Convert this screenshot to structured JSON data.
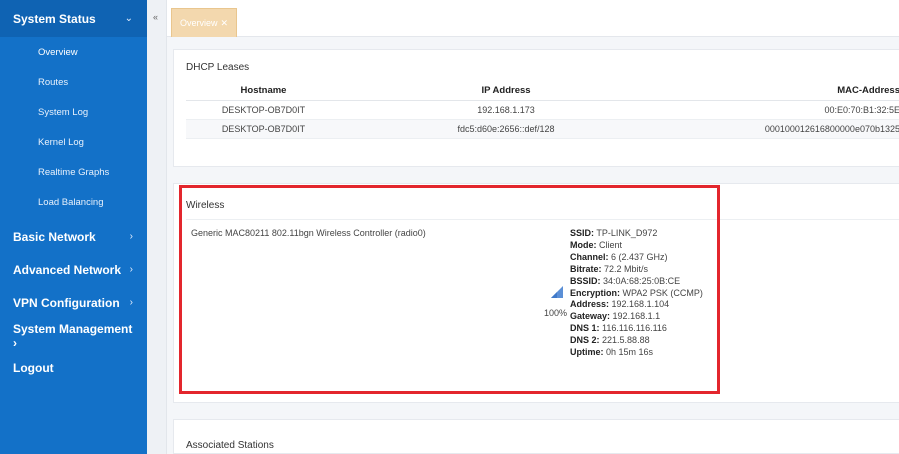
{
  "sidebar": {
    "system_status": {
      "label": "System Status",
      "caret": "⌄"
    },
    "sub_items": [
      {
        "label": "Overview"
      },
      {
        "label": "Routes"
      },
      {
        "label": "System Log"
      },
      {
        "label": "Kernel Log"
      },
      {
        "label": "Realtime Graphs"
      },
      {
        "label": "Load Balancing"
      }
    ],
    "sections": [
      {
        "label": "Basic Network",
        "caret": "›"
      },
      {
        "label": "Advanced Network",
        "caret": "›"
      },
      {
        "label": "VPN Configuration",
        "caret": "›"
      },
      {
        "label": "System Management ›",
        "caret": ""
      }
    ],
    "logout": "Logout"
  },
  "collapse_icon": "«",
  "tabs": [
    {
      "label": "Overview",
      "close": "✕"
    }
  ],
  "dhcp": {
    "title": "DHCP Leases",
    "headers": [
      "Hostname",
      "IP Address",
      "MAC-Address"
    ],
    "rows": [
      [
        "DESKTOP-OB7D0IT",
        "192.168.1.173",
        "00:E0:70:B1:32:5E"
      ],
      [
        "DESKTOP-OB7D0IT",
        "fdc5:d60e:2656::def/128",
        "000100012616800000e070b1325"
      ]
    ]
  },
  "wireless": {
    "title": "Wireless",
    "device": "Generic MAC80211 802.11bgn Wireless Controller (radio0)",
    "signal_percent": "100%",
    "details": [
      {
        "key": "SSID:",
        "value": "TP-LINK_D972"
      },
      {
        "key": "Mode:",
        "value": "Client"
      },
      {
        "key": "Channel:",
        "value": "6 (2.437 GHz)"
      },
      {
        "key": "Bitrate:",
        "value": "72.2 Mbit/s"
      },
      {
        "key": "BSSID:",
        "value": "34:0A:68:25:0B:CE"
      },
      {
        "key": "Encryption:",
        "value": "WPA2 PSK (CCMP)"
      },
      {
        "key": "Address:",
        "value": "192.168.1.104"
      },
      {
        "key": "Gateway:",
        "value": "192.168.1.1"
      },
      {
        "key": "DNS 1:",
        "value": "116.116.116.116"
      },
      {
        "key": "DNS 2:",
        "value": "221.5.88.88"
      },
      {
        "key": "Uptime:",
        "value": "0h 15m 16s"
      }
    ]
  },
  "stations": {
    "title": "Associated Stations"
  },
  "colors": {
    "sidebar": "#1371c8",
    "highlight": "#e3262d",
    "tab": "#f3d8ae"
  }
}
